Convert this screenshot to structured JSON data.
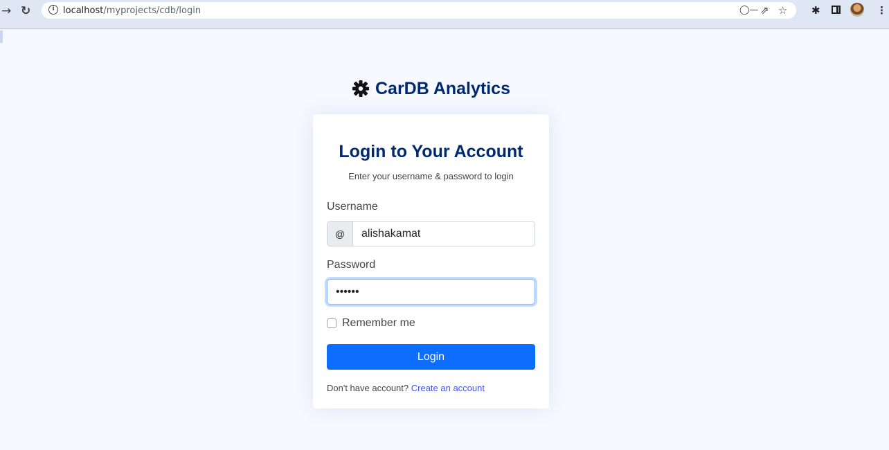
{
  "browser": {
    "url_host": "localhost",
    "url_path": "/myprojects/cdb/login",
    "icons": [
      "back-icon",
      "reload-icon",
      "info-icon",
      "key-icon",
      "share-icon",
      "star-icon",
      "extensions-icon",
      "side-panel-icon",
      "profile-avatar",
      "menu-icon"
    ]
  },
  "brand": {
    "name": "CarDB Analytics",
    "icon": "gear-icon",
    "color": "#012970"
  },
  "login": {
    "title": "Login to Your Account",
    "subtitle": "Enter your username & password to login",
    "username_label": "Username",
    "username_addon": "@",
    "username_value": "alishakamat",
    "password_label": "Password",
    "password_value": "••••••",
    "remember_label": "Remember me",
    "remember_checked": false,
    "submit_label": "Login",
    "signup_prompt": "Don't have account?",
    "signup_link": "Create an account",
    "accent_color": "#0d6efd",
    "link_color": "#4154f1"
  }
}
